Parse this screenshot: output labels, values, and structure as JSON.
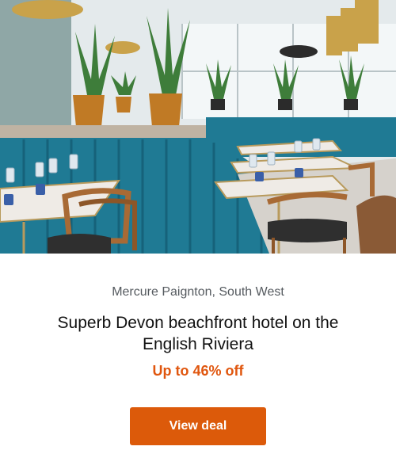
{
  "hero": {
    "image_subject": "restaurant-interior-photo"
  },
  "deal": {
    "location": "Mercure Paignton, South West",
    "title": "Superb Devon beachfront hotel on the English Riviera",
    "discount": "Up to 46% off",
    "cta_label": "View deal"
  },
  "colors": {
    "accent": "#dc5a0a",
    "discount_text": "#e0560e",
    "booth": "#1f7a94"
  }
}
